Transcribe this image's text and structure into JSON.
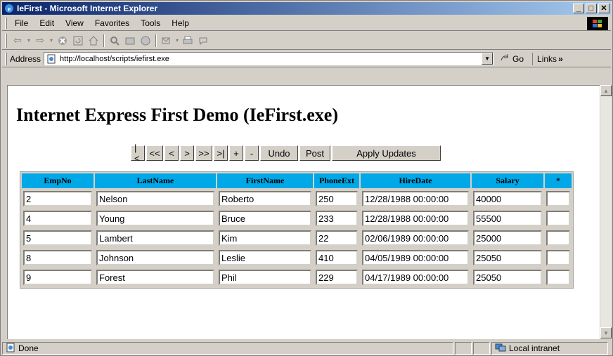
{
  "window": {
    "title": "IeFirst - Microsoft Internet Explorer"
  },
  "menu": {
    "items": [
      "File",
      "Edit",
      "View",
      "Favorites",
      "Tools",
      "Help"
    ]
  },
  "address": {
    "label": "Address",
    "url": "http://localhost/scripts/iefirst.exe",
    "go": "Go",
    "links": "Links"
  },
  "page": {
    "title": "Internet Express First Demo (IeFirst.exe)"
  },
  "nav": {
    "first": "|<",
    "prior_page": "<<",
    "prior": "<",
    "next": ">",
    "next_page": ">>",
    "last": ">|",
    "insert": "+",
    "delete": "-",
    "undo": "Undo",
    "post": "Post",
    "apply": "Apply Updates"
  },
  "table": {
    "headers": [
      "EmpNo",
      "LastName",
      "FirstName",
      "PhoneExt",
      "HireDate",
      "Salary",
      "*"
    ],
    "rows": [
      [
        "2",
        "Nelson",
        "Roberto",
        "250",
        "12/28/1988 00:00:00",
        "40000",
        ""
      ],
      [
        "4",
        "Young",
        "Bruce",
        "233",
        "12/28/1988 00:00:00",
        "55500",
        ""
      ],
      [
        "5",
        "Lambert",
        "Kim",
        "22",
        "02/06/1989 00:00:00",
        "25000",
        ""
      ],
      [
        "8",
        "Johnson",
        "Leslie",
        "410",
        "04/05/1989 00:00:00",
        "25050",
        ""
      ],
      [
        "9",
        "Forest",
        "Phil",
        "229",
        "04/17/1989 00:00:00",
        "25050",
        ""
      ]
    ]
  },
  "status": {
    "text": "Done",
    "zone": "Local intranet"
  },
  "colors": {
    "header_bg": "#00a8e8",
    "title_gradient_start": "#0a246a",
    "chrome": "#d4d0c8"
  }
}
